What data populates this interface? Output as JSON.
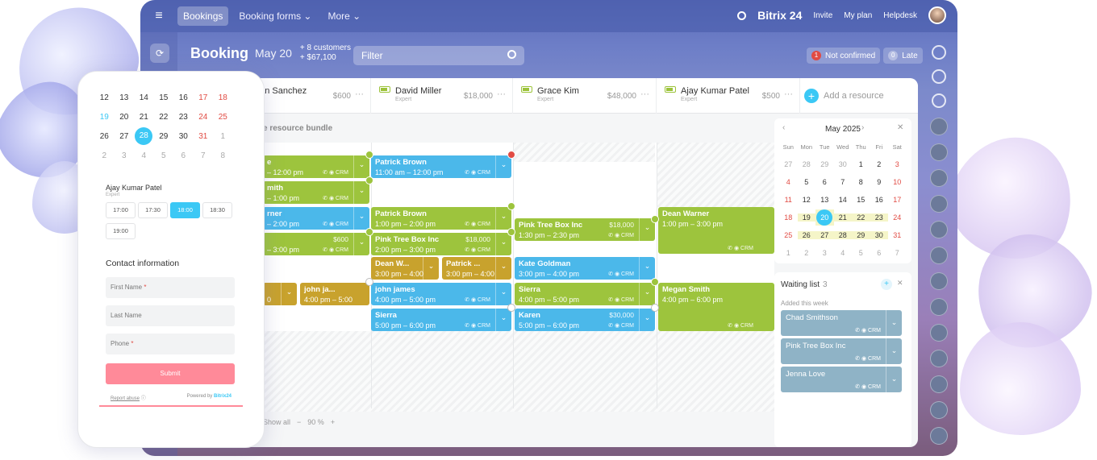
{
  "topbar": {
    "tabs": [
      {
        "label": "Bookings"
      },
      {
        "label": "Booking forms ⌄"
      },
      {
        "label": "More ⌄"
      }
    ],
    "brand": "Bitrix 24",
    "links": [
      "Invite",
      "My plan",
      "Helpdesk"
    ]
  },
  "header": {
    "title": "Booking",
    "date": "May 20",
    "customers": "+ 8 customers",
    "amount": "+ $67,100",
    "filter_placeholder": "Filter",
    "not_confirmed_count": "1",
    "not_confirmed_label": "Not confirmed",
    "late_count": "0",
    "late_label": "Late"
  },
  "resources": [
    {
      "name": "Megan Sanchez",
      "visible_name": "gan Sanchez",
      "role": "",
      "price": "$600"
    },
    {
      "name": "David Miller",
      "role": "Expert",
      "price": "$18,000"
    },
    {
      "name": "Grace Kim",
      "role": "Expert",
      "price": "$48,000"
    },
    {
      "name": "Ajay Kumar Patel",
      "role": "Expert",
      "price": "$500"
    }
  ],
  "add_resource": "Add a resource",
  "bundle_label": "e resource bundle",
  "events": {
    "c0_1": {
      "title": "e",
      "time": "– 12:00 pm"
    },
    "c0_2": {
      "title": "mith",
      "time": "– 1:00 pm"
    },
    "c0_3": {
      "title": "rner",
      "time": "– 2:00 pm"
    },
    "c0_4": {
      "price": "$600",
      "time": "– 3:00 pm"
    },
    "c0_5": {
      "time": "0"
    },
    "c0_6": {
      "title": "john ja...",
      "time": "4:00 pm – 5:00"
    },
    "c1_1": {
      "title": "Patrick Brown",
      "time": "11:00 am – 12:00 pm"
    },
    "c1_2": {
      "title": "Patrick Brown",
      "time": "1:00 pm – 2:00 pm"
    },
    "c1_3": {
      "title": "Pink Tree Box Inc",
      "price": "$18,000",
      "time": "2:00 pm – 3:00 pm"
    },
    "c1_4": {
      "title": "Dean W...",
      "time": "3:00 pm – 4:00"
    },
    "c1_5": {
      "title": "Patrick ...",
      "time": "3:00 pm – 4:00"
    },
    "c1_6": {
      "title": "john james",
      "time": "4:00 pm – 5:00 pm"
    },
    "c1_7": {
      "title": "Sierra",
      "time": "5:00 pm – 6:00 pm"
    },
    "c2_1": {
      "title": "Pink Tree Box Inc",
      "price": "$18,000",
      "time": "1:30 pm – 2:30 pm"
    },
    "c2_2": {
      "title": "Kate Goldman",
      "time": "3:00 pm – 4:00 pm"
    },
    "c2_3": {
      "title": "Sierra",
      "time": "4:00 pm – 5:00 pm"
    },
    "c2_4": {
      "title": "Karen",
      "price": "$30,000",
      "time": "5:00 pm – 6:00 pm"
    },
    "c3_1": {
      "title": "Dean Warner",
      "time": "1:00 pm – 3:00 pm"
    },
    "c3_2": {
      "title": "Megan Smith",
      "time": "4:00 pm – 6:00 pm"
    }
  },
  "event_icons": "✆ ◉ CRM",
  "bottom": {
    "show_all": "Show all",
    "zoom": "90 %",
    "minus": "−",
    "plus": "+"
  },
  "mini_calendar": {
    "month": "May 2025",
    "weekdays": [
      "Sun",
      "Mon",
      "Tue",
      "Wed",
      "Thu",
      "Fri",
      "Sat"
    ],
    "weeks": [
      [
        "27",
        "28",
        "29",
        "30",
        "1",
        "2",
        "3"
      ],
      [
        "4",
        "5",
        "6",
        "7",
        "8",
        "9",
        "10"
      ],
      [
        "11",
        "12",
        "13",
        "14",
        "15",
        "16",
        "17"
      ],
      [
        "18",
        "19",
        "20",
        "21",
        "22",
        "23",
        "24"
      ],
      [
        "25",
        "26",
        "27",
        "28",
        "29",
        "30",
        "31"
      ],
      [
        "1",
        "2",
        "3",
        "4",
        "5",
        "6",
        "7"
      ]
    ],
    "today": "20"
  },
  "waiting_list": {
    "title": "Waiting list",
    "count": "3",
    "subtitle": "Added this week",
    "items": [
      {
        "name": "Chad Smithson"
      },
      {
        "name": "Pink Tree Box Inc"
      },
      {
        "name": "Jenna Love"
      }
    ]
  },
  "phone": {
    "weeks": [
      [
        "12",
        "13",
        "14",
        "15",
        "16",
        "17",
        "18"
      ],
      [
        "19",
        "20",
        "21",
        "22",
        "23",
        "24",
        "25"
      ],
      [
        "26",
        "27",
        "28",
        "29",
        "30",
        "31",
        "1"
      ],
      [
        "2",
        "3",
        "4",
        "5",
        "6",
        "7",
        "8"
      ]
    ],
    "today": "28",
    "resource_name": "Ajay Kumar Patel",
    "resource_role": "Expert",
    "slots": [
      "17:00",
      "17:30",
      "18:00",
      "18:30",
      "19:00"
    ],
    "selected_slot": "18:00",
    "contact_title": "Contact information",
    "fields": [
      {
        "label": "First Name",
        "required": true
      },
      {
        "label": "Last Name",
        "required": false
      },
      {
        "label": "Phone",
        "required": true
      }
    ],
    "submit": "Submit",
    "report_abuse": "Report abuse",
    "powered_by": "Powered by",
    "powered_brand": "Bitrix24"
  }
}
